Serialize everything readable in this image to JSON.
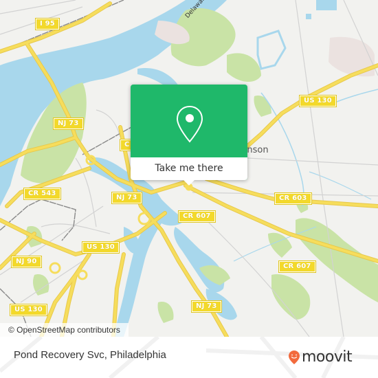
{
  "map": {
    "colors": {
      "land": "#f2f2ef",
      "water": "#a8d7ec",
      "park": "#c9e3a6",
      "industrial": "#ebe2e0",
      "highway": "#f6dd5c",
      "highway_casing": "#e7c84a",
      "minor_road": "#d2d2d2",
      "rail": "#777777",
      "shield_bg": "#f3d92b"
    },
    "route_shields": [
      {
        "id": "i95",
        "label": "I 95"
      },
      {
        "id": "nj73-north",
        "label": "NJ 73"
      },
      {
        "id": "cr-west-partial",
        "label": "C"
      },
      {
        "id": "us130-northeast",
        "label": "US 130"
      },
      {
        "id": "cr543",
        "label": "CR 543"
      },
      {
        "id": "nj73-center",
        "label": "NJ 73"
      },
      {
        "id": "cr603",
        "label": "CR 603"
      },
      {
        "id": "cr607-center",
        "label": "CR 607"
      },
      {
        "id": "us130-center",
        "label": "US 130"
      },
      {
        "id": "nj90",
        "label": "NJ 90"
      },
      {
        "id": "cr607-east",
        "label": "CR 607"
      },
      {
        "id": "nj73-south",
        "label": "NJ 73"
      },
      {
        "id": "us130-southwest",
        "label": "US 130"
      }
    ],
    "place_labels": [
      {
        "id": "cinnaminson",
        "label": "Cinnaminson"
      }
    ],
    "water_labels": [
      {
        "id": "delaware-river",
        "label": "Delaware"
      }
    ],
    "attribution": "© OpenStreetMap contributors"
  },
  "popup": {
    "icon": "map-pin-icon",
    "cta_label": "Take me there",
    "accent_color": "#1fb86a"
  },
  "footer": {
    "place_name": "Pond Recovery Svc, Philadelphia",
    "brand": "moovit",
    "brand_color": "#f26a3d"
  }
}
